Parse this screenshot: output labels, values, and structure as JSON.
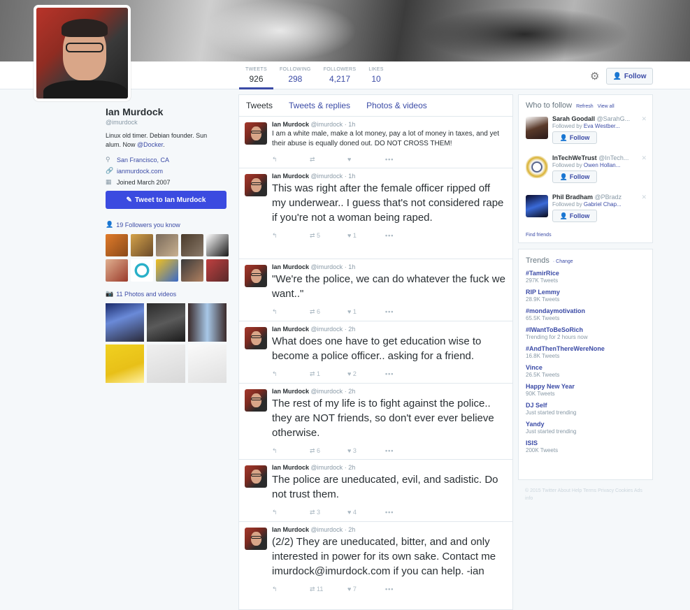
{
  "profile": {
    "name": "Ian Murdock",
    "handle": "@imurdock",
    "bio_text": "Linux old timer. Debian founder. Sun alum. Now ",
    "bio_link": "@Docker",
    "bio_end": ".",
    "location": "San Francisco, CA",
    "website": "ianmurdock.com",
    "joined": "Joined March 2007",
    "tweet_to_label": "Tweet to Ian Murdock",
    "followers_you_know": "19 Followers you know",
    "photos_videos": "11 Photos and videos"
  },
  "stats": [
    {
      "label": "TWEETS",
      "value": "926"
    },
    {
      "label": "FOLLOWING",
      "value": "298"
    },
    {
      "label": "FOLLOWERS",
      "value": "4,217"
    },
    {
      "label": "LIKES",
      "value": "10"
    }
  ],
  "follow_label": "Follow",
  "timeline_tabs": [
    "Tweets",
    "Tweets & replies",
    "Photos & videos"
  ],
  "tweets": [
    {
      "name": "Ian Murdock",
      "handle": "@imurdock",
      "time": "· 1h",
      "text": "I am a white male, make a lot money, pay a lot of money in taxes, and yet their abuse is equally doned out. DO NOT CROSS THEM!",
      "retweets": "",
      "likes": ""
    },
    {
      "name": "Ian Murdock",
      "handle": "@imurdock",
      "time": "· 1h",
      "text": "This was right after the female officer ripped off my underwear.. I guess that's not considered rape if you're not a woman being raped.",
      "retweets": "5",
      "likes": "1"
    },
    {
      "name": "Ian Murdock",
      "handle": "@imurdock",
      "time": "· 1h",
      "text": "\"We're the police, we can do whatever the fuck we want..\"",
      "retweets": "6",
      "likes": "1"
    },
    {
      "name": "Ian Murdock",
      "handle": "@imurdock",
      "time": "· 2h",
      "text": "What does one have to get education wise to become a police officer.. asking for a friend.",
      "retweets": "1",
      "likes": "2"
    },
    {
      "name": "Ian Murdock",
      "handle": "@imurdock",
      "time": "· 2h",
      "text": "The rest of my life is to fight against the police.. they are NOT friends, so don't ever ever believe otherwise.",
      "retweets": "6",
      "likes": "3"
    },
    {
      "name": "Ian Murdock",
      "handle": "@imurdock",
      "time": "· 2h",
      "text": "The police are uneducated, evil, and sadistic. Do not trust them.",
      "retweets": "3",
      "likes": "4"
    },
    {
      "name": "Ian Murdock",
      "handle": "@imurdock",
      "time": "· 2h",
      "text": "(2/2) They are uneducated, bitter, and and only interested in power for its own sake. Contact me imurdock@imurdock.com if you can help. -ian",
      "retweets": "11",
      "likes": "7"
    }
  ],
  "who_to_follow": {
    "title": "Who to follow",
    "refresh": "Refresh",
    "view_all": "View all",
    "items": [
      {
        "name": "Sarah Goodall",
        "handle": "@SarahG...",
        "followed_by": "Followed by ",
        "followed_name": "Eva Westber..."
      },
      {
        "name": "InTechWeTrust",
        "handle": "@InTech...",
        "followed_by": "Followed by ",
        "followed_name": "Owen Hollan..."
      },
      {
        "name": "Phil Bradham",
        "handle": "@PBradz",
        "followed_by": "Followed by ",
        "followed_name": "Gabriel Chap..."
      }
    ],
    "find_friends": "Find friends"
  },
  "trends": {
    "title": "Trends",
    "change": "· Change",
    "items": [
      {
        "name": "#TamirRice",
        "count": "297K Tweets"
      },
      {
        "name": "RIP Lemmy",
        "count": "28.9K Tweets"
      },
      {
        "name": "#mondaymotivation",
        "count": "65.5K Tweets"
      },
      {
        "name": "#IWantToBeSoRich",
        "count": "Trending for 2 hours now"
      },
      {
        "name": "#AndThenThereWereNone",
        "count": "16.8K Tweets"
      },
      {
        "name": "Vince",
        "count": "26.5K Tweets"
      },
      {
        "name": "Happy New Year",
        "count": "90K Tweets"
      },
      {
        "name": "DJ Self",
        "count": "Just started trending"
      },
      {
        "name": "Yandy",
        "count": "Just started trending"
      },
      {
        "name": "ISIS",
        "count": "200K Tweets"
      }
    ]
  },
  "footer": "© 2015 Twitter   About   Help   Terms   Privacy   Cookies   Ads info"
}
